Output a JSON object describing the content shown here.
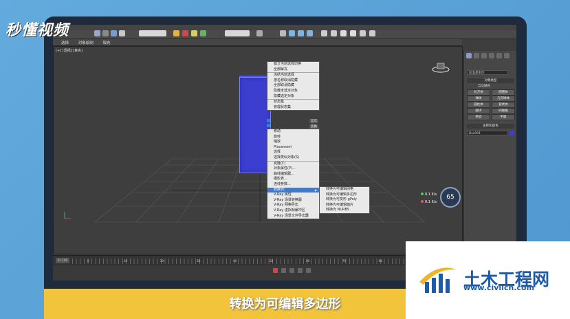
{
  "logo_text": "秒懂视频",
  "subtitle": "转换为可编辑多边形",
  "brand": {
    "name": "土木工程网",
    "url": "www.civilcn.com"
  },
  "ribbon": {
    "tabs": [
      "选择",
      "对象绘制",
      "填充"
    ]
  },
  "viewport": {
    "label": "[+] [透视] [真实]"
  },
  "context_menu": {
    "top_items": [
      "孤立当前选择切换",
      "全部解冻",
      "冻结当前选择",
      "按名称取消隐藏",
      "全部取消隐藏",
      "隐藏未选定对象",
      "隐藏选定对象",
      "状态集",
      "管理状态集"
    ],
    "labels": {
      "display": "显示",
      "transform": "变换"
    },
    "items": [
      "移动",
      "旋转",
      "缩放",
      "Placement",
      "选择",
      "选择类似对象(S)",
      "克隆(C)",
      "对象属性(P)...",
      "曲线编辑器...",
      "摄影表...",
      "连线参数...",
      "转换为:",
      "V-Ray 属性",
      "V-Ray 场景转换器",
      "V-Ray 网格导出",
      "V-Ray 虚拟帧缓冲区",
      "V-Ray 场景文件导出器"
    ],
    "selected_index": 11,
    "submenu": [
      "转换为可编辑网格",
      "转换为可编辑多边形",
      "转换为可变形 gPoly",
      "转换为可编辑面片",
      "转换为 NURBS"
    ]
  },
  "panel": {
    "search_placeholder": "标准基本体",
    "object_type_header": "对象类型",
    "autogrid": "自动栅格",
    "buttons": [
      "长方体",
      "圆锥体",
      "球体",
      "几何球体",
      "圆柱体",
      "管状体",
      "圆环",
      "四棱锥",
      "茶壶",
      "平面"
    ],
    "name_color_header": "名称和颜色",
    "object_name": "Box001"
  },
  "timeline": {
    "frame": "0 / 100",
    "ticks": [
      "0",
      "10",
      "20",
      "30",
      "40",
      "50",
      "60",
      "70",
      "80",
      "90",
      "100"
    ]
  },
  "perf": {
    "gauge": "65",
    "up": "0.1",
    "down": "0.1",
    "up_unit": "K/s",
    "down_unit": "K/s"
  },
  "colors": {
    "accent": "#3a7bd5",
    "object": "#3c3ed0",
    "band": "#f1c43c",
    "brand": "#1e5aa8"
  }
}
